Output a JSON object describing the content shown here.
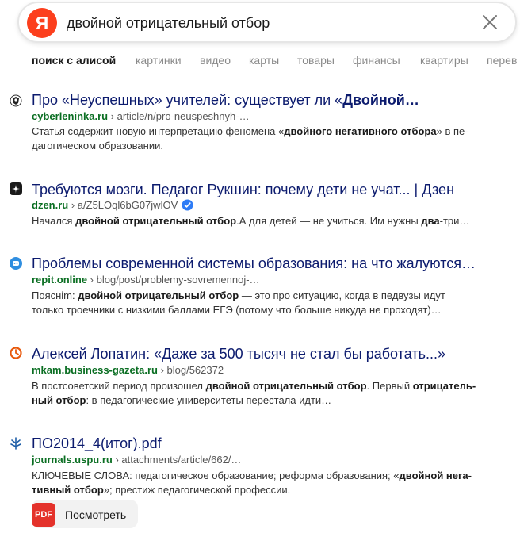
{
  "search": {
    "logo_letter": "Я",
    "query": "двойной отрицательный отбор"
  },
  "tabs": [
    "поиск с алисой",
    "картинки",
    "видео",
    "карты",
    "товары",
    "финансы",
    "квартиры",
    "перев"
  ],
  "results": [
    {
      "favicon": "cyberleninka-icon",
      "title_plain": "Про «Неуспешных» учителей: существует ли «",
      "title_bold": "Двойной…",
      "host": "cyberleninka.ru",
      "path": " › article/n/pro-neuspeshnyh-…",
      "snippet_parts": [
        "Статья содержит новую интерпретацию феномена «",
        "двойного негативного отбора",
        "» в пе-"
      ],
      "snippet_line2": "дагогическом образовании."
    },
    {
      "favicon": "dzen-icon",
      "title_plain": "Требуются мозги. Педагог Рукшин: почему дети не учат... | Дзен",
      "host": "dzen.ru",
      "path": " › a/Z5LOql6bG07jwlOV",
      "verified": true,
      "snippet_parts": [
        "Начался ",
        "двойной отрицательный отбор",
        ".А для детей — не учиться. Им нужны ",
        "два",
        "-три…"
      ]
    },
    {
      "favicon": "repit-icon",
      "title_plain": "Проблемы современной системы образования: на что жалуются…",
      "host": "repit.online",
      "path": " › blog/post/problemy-sovremennoj-…",
      "snippet_parts": [
        "Пояснim: ",
        "двойной отрицательный отбор",
        " — это про ситуацию, когда в педвузы идут"
      ],
      "snippet_line2": "только троечники с низкими баллами ЕГЭ (потому что больше никуда не проходят)…"
    },
    {
      "favicon": "business-gazeta-icon",
      "title_plain": "Алексей Лопатин: «Даже за 500 тысяч не стал бы работать...»",
      "host": "mkam.business-gazeta.ru",
      "path": " › blog/562372",
      "snippet_parts": [
        "В постсоветский период произошел ",
        "двойной отрицательный отбор",
        ". Первый ",
        "отрицатель-"
      ],
      "snippet_line2_parts": [
        "ный отбор",
        ": в педагогические университеты перестала идти…"
      ]
    },
    {
      "favicon": "uspu-icon",
      "title_plain": "ПО2014_4(итог).pdf",
      "host": "journals.uspu.ru",
      "path": " › attachments/article/662/…",
      "snippet_parts": [
        "КЛЮЧЕВЫЕ СЛОВА: педагогическое образование; реформа образования; «",
        "двойной нега-"
      ],
      "snippet_line2_parts": [
        "тивный отбор",
        "»; престиж педагогической профессии."
      ],
      "pdf_badge": "PDF",
      "pdf_button": "Посмотреть"
    }
  ],
  "colors": {
    "title": "#0c1b6e",
    "host": "#0a6e22",
    "logo": "#fc3f1d",
    "pdf": "#e4322b"
  }
}
